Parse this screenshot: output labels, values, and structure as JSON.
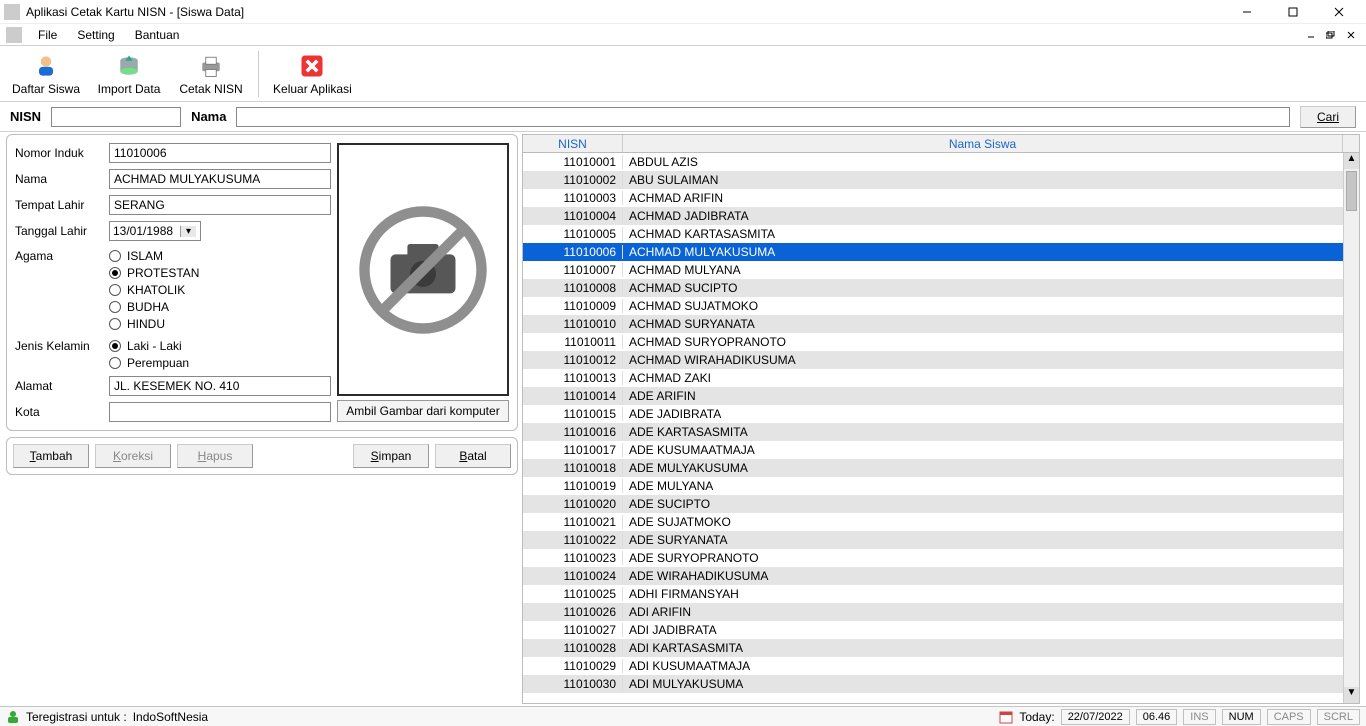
{
  "window": {
    "title": "Aplikasi Cetak Kartu NISN - [Siswa Data]"
  },
  "menu": {
    "file": "File",
    "setting": "Setting",
    "bantuan": "Bantuan"
  },
  "toolbar": {
    "daftar_siswa": "Daftar Siswa",
    "import_data": "Import Data",
    "cetak_nisn": "Cetak NISN",
    "keluar": "Keluar Aplikasi"
  },
  "search": {
    "nisn_label": "NISN",
    "nisn_value": "",
    "nama_label": "Nama",
    "nama_value": "",
    "cari_label": "Cari"
  },
  "form": {
    "labels": {
      "nomor_induk": "Nomor Induk",
      "nama": "Nama",
      "tempat_lahir": "Tempat Lahir",
      "tanggal_lahir": "Tanggal Lahir",
      "agama": "Agama",
      "jenis_kelamin": "Jenis Kelamin",
      "alamat": "Alamat",
      "kota": "Kota"
    },
    "values": {
      "nomor_induk": "11010006",
      "nama": "ACHMAD MULYAKUSUMA",
      "tempat_lahir": "SERANG",
      "tanggal_lahir": "13/01/1988",
      "alamat": "JL. KESEMEK NO. 410",
      "kota": ""
    },
    "agama_options": [
      "ISLAM",
      "PROTESTAN",
      "KHATOLIK",
      "BUDHA",
      "HINDU"
    ],
    "agama_selected": "PROTESTAN",
    "jk_options": [
      "Laki - Laki",
      "Perempuan"
    ],
    "jk_selected": "Laki - Laki",
    "photo_button": "Ambil Gambar dari komputer"
  },
  "actions": {
    "tambah": "Tambah",
    "koreksi": "Koreksi",
    "hapus": "Hapus",
    "simpan": "Simpan",
    "batal": "Batal"
  },
  "table": {
    "headers": {
      "nisn": "NISN",
      "nama": "Nama Siswa"
    },
    "selected_nisn": "11010006",
    "rows": [
      {
        "nisn": "11010001",
        "nama": "ABDUL AZIS"
      },
      {
        "nisn": "11010002",
        "nama": "ABU SULAIMAN"
      },
      {
        "nisn": "11010003",
        "nama": "ACHMAD ARIFIN"
      },
      {
        "nisn": "11010004",
        "nama": "ACHMAD JADIBRATA"
      },
      {
        "nisn": "11010005",
        "nama": "ACHMAD KARTASASMITA"
      },
      {
        "nisn": "11010006",
        "nama": "ACHMAD MULYAKUSUMA"
      },
      {
        "nisn": "11010007",
        "nama": "ACHMAD MULYANA"
      },
      {
        "nisn": "11010008",
        "nama": "ACHMAD SUCIPTO"
      },
      {
        "nisn": "11010009",
        "nama": "ACHMAD SUJATMOKO"
      },
      {
        "nisn": "11010010",
        "nama": "ACHMAD SURYANATA"
      },
      {
        "nisn": "11010011",
        "nama": "ACHMAD SURYOPRANOTO"
      },
      {
        "nisn": "11010012",
        "nama": "ACHMAD WIRAHADIKUSUMA"
      },
      {
        "nisn": "11010013",
        "nama": "ACHMAD ZAKI"
      },
      {
        "nisn": "11010014",
        "nama": "ADE ARIFIN"
      },
      {
        "nisn": "11010015",
        "nama": "ADE JADIBRATA"
      },
      {
        "nisn": "11010016",
        "nama": "ADE KARTASASMITA"
      },
      {
        "nisn": "11010017",
        "nama": "ADE KUSUMAATMAJA"
      },
      {
        "nisn": "11010018",
        "nama": "ADE MULYAKUSUMA"
      },
      {
        "nisn": "11010019",
        "nama": "ADE MULYANA"
      },
      {
        "nisn": "11010020",
        "nama": "ADE SUCIPTO"
      },
      {
        "nisn": "11010021",
        "nama": "ADE SUJATMOKO"
      },
      {
        "nisn": "11010022",
        "nama": "ADE SURYANATA"
      },
      {
        "nisn": "11010023",
        "nama": "ADE SURYOPRANOTO"
      },
      {
        "nisn": "11010024",
        "nama": "ADE WIRAHADIKUSUMA"
      },
      {
        "nisn": "11010025",
        "nama": "ADHI FIRMANSYAH"
      },
      {
        "nisn": "11010026",
        "nama": "ADI ARIFIN"
      },
      {
        "nisn": "11010027",
        "nama": "ADI JADIBRATA"
      },
      {
        "nisn": "11010028",
        "nama": "ADI KARTASASMITA"
      },
      {
        "nisn": "11010029",
        "nama": "ADI KUSUMAATMAJA"
      },
      {
        "nisn": "11010030",
        "nama": "ADI MULYAKUSUMA"
      }
    ]
  },
  "status": {
    "reg_label": "Teregistrasi untuk :",
    "reg_value": "IndoSoftNesia",
    "today_label": "Today:",
    "today_date": "22/07/2022",
    "today_time": "06.46",
    "ins": "INS",
    "num": "NUM",
    "caps": "CAPS",
    "scrl": "SCRL"
  }
}
